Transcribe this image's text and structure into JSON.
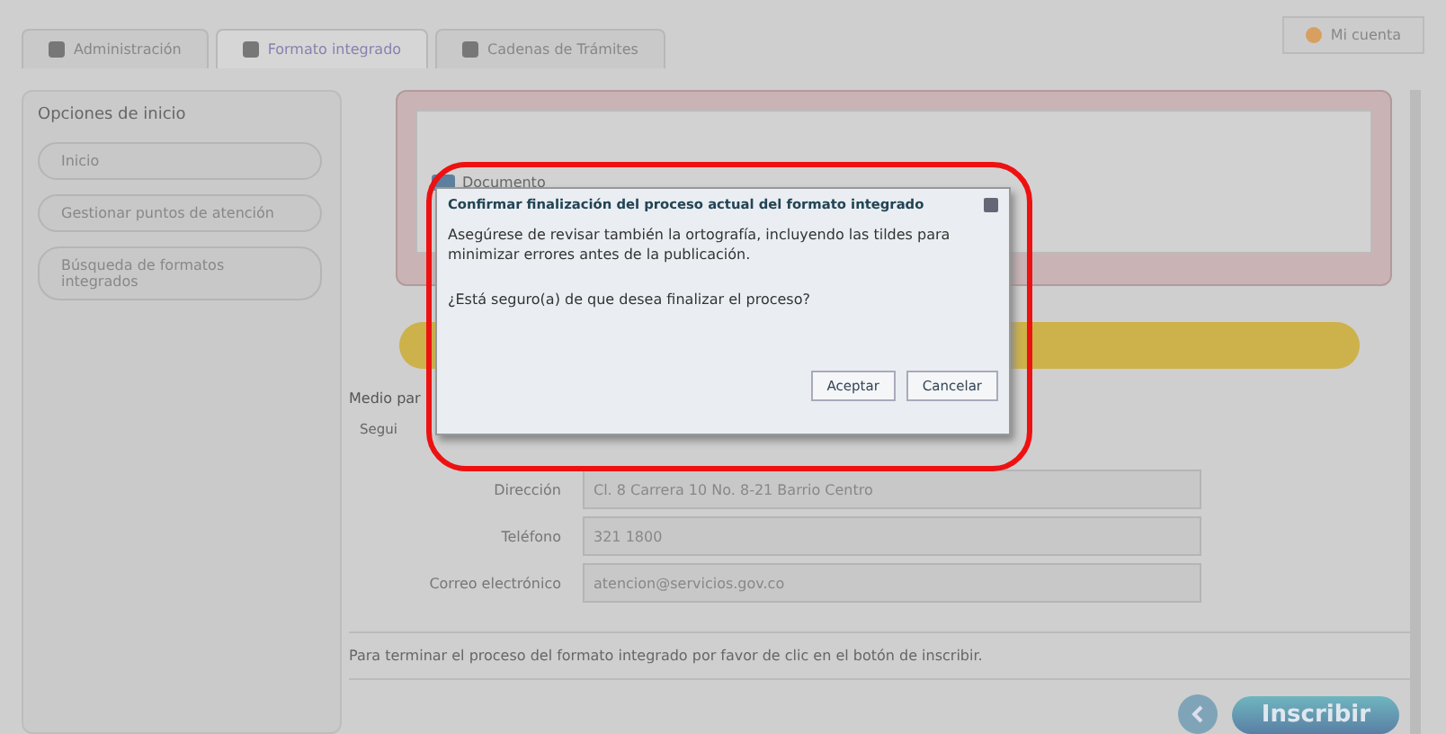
{
  "tabs": [
    {
      "label": "Administración",
      "selected": false
    },
    {
      "label": "Formato integrado",
      "selected": true
    },
    {
      "label": "Cadenas de Trámites",
      "selected": false
    }
  ],
  "account_button": "Mi cuenta",
  "sidebar": {
    "title": "Opciones de inicio",
    "items": [
      "Inicio",
      "Gestionar puntos de atención",
      "Búsqueda de formatos integrados"
    ]
  },
  "document_panel": {
    "node_label": "Documento"
  },
  "section": {
    "title": "Medio par",
    "subsection": "Segui",
    "fields": [
      {
        "label": "Dirección",
        "value": "Cl. 8 Carrera 10 No. 8-21 Barrio Centro"
      },
      {
        "label": "Teléfono",
        "value": "321 1800"
      },
      {
        "label": "Correo electrónico",
        "value": "atencion@servicios.gov.co"
      }
    ]
  },
  "footer": {
    "message": "Para terminar el proceso del formato integrado por favor de clic en el botón de inscribir.",
    "submit": "Inscribir"
  },
  "dialog": {
    "title": "Confirmar finalización del proceso actual del formato integrado",
    "message": "Asegúrese de revisar también la ortografía, incluyendo las tildes para minimizar errores antes de la publicación.",
    "question": "¿Está seguro(a) de que desea finalizar el proceso?",
    "buttons": [
      "Aceptar",
      "Cancelar"
    ]
  }
}
